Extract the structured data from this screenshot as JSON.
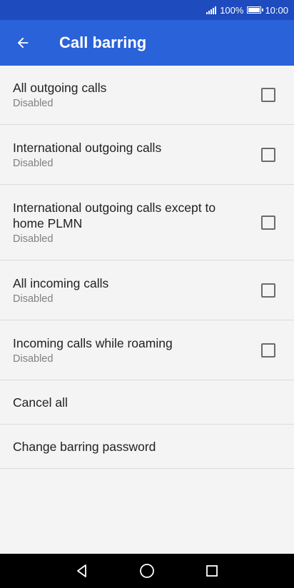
{
  "status_bar": {
    "battery": "100%",
    "time": "10:00"
  },
  "app_bar": {
    "title": "Call barring"
  },
  "items": [
    {
      "title": "All outgoing calls",
      "subtitle": "Disabled",
      "checked": false
    },
    {
      "title": "International outgoing calls",
      "subtitle": "Disabled",
      "checked": false
    },
    {
      "title": "International outgoing calls except to home PLMN",
      "subtitle": "Disabled",
      "checked": false
    },
    {
      "title": "All incoming calls",
      "subtitle": "Disabled",
      "checked": false
    },
    {
      "title": "Incoming calls while roaming",
      "subtitle": "Disabled",
      "checked": false
    }
  ],
  "actions": {
    "cancel_all": "Cancel all",
    "change_password": "Change barring password"
  },
  "icons": {
    "back": "arrow-left-icon",
    "nav_back": "triangle-back-icon",
    "nav_home": "circle-home-icon",
    "nav_recents": "square-recents-icon"
  },
  "colors": {
    "status_bar": "#1e4bbd",
    "app_bar": "#2962d9",
    "background": "#f4f4f4"
  }
}
